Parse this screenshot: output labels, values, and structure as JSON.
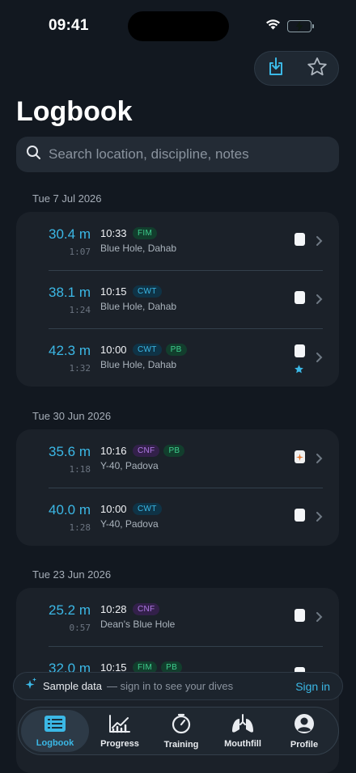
{
  "status": {
    "time": "09:41"
  },
  "header": {
    "title": "Logbook",
    "actions": [
      {
        "icon": "import-icon"
      },
      {
        "icon": "star-icon"
      }
    ]
  },
  "search": {
    "placeholder": "Search location, discipline, notes",
    "value": ""
  },
  "sections": [
    {
      "date": "Tue 7 Jul 2026",
      "dives": [
        {
          "depth": "30.4 m",
          "duration": "1:07",
          "time": "10:33",
          "tags": [
            "FIM"
          ],
          "location": "Blue Hole, Dahab",
          "thumb": "white",
          "starred": false
        },
        {
          "depth": "38.1 m",
          "duration": "1:24",
          "time": "10:15",
          "tags": [
            "CWT"
          ],
          "location": "Blue Hole, Dahab",
          "thumb": "white",
          "starred": false
        },
        {
          "depth": "42.3 m",
          "duration": "1:32",
          "time": "10:00",
          "tags": [
            "CWT",
            "PB"
          ],
          "location": "Blue Hole, Dahab",
          "thumb": "white",
          "starred": true
        }
      ]
    },
    {
      "date": "Tue 30 Jun 2026",
      "dives": [
        {
          "depth": "35.6 m",
          "duration": "1:18",
          "time": "10:16",
          "tags": [
            "CNF",
            "PB"
          ],
          "location": "Y-40, Padova",
          "thumb": "sun",
          "starred": false
        },
        {
          "depth": "40.0 m",
          "duration": "1:28",
          "time": "10:00",
          "tags": [
            "CWT"
          ],
          "location": "Y-40, Padova",
          "thumb": "white",
          "starred": false
        }
      ]
    },
    {
      "date": "Tue 23 Jun 2026",
      "dives": [
        {
          "depth": "25.2 m",
          "duration": "0:57",
          "time": "10:28",
          "tags": [
            "CNF"
          ],
          "location": "Dean's Blue Hole",
          "thumb": "white",
          "starred": false
        },
        {
          "depth": "32.0 m",
          "duration": "",
          "time": "10:15",
          "tags": [
            "FIM",
            "PB"
          ],
          "location": "",
          "thumb": "white",
          "starred": false
        }
      ]
    }
  ],
  "banner": {
    "label": "Sample data",
    "sub": "— sign in to see your dives",
    "action": "Sign in"
  },
  "tabs": [
    {
      "label": "Logbook",
      "icon": "logbook-icon",
      "active": true
    },
    {
      "label": "Progress",
      "icon": "chart-icon",
      "active": false
    },
    {
      "label": "Training",
      "icon": "timer-icon",
      "active": false
    },
    {
      "label": "Mouthfill",
      "icon": "lungs-icon",
      "active": false
    },
    {
      "label": "Profile",
      "icon": "person-icon",
      "active": false
    }
  ],
  "colors": {
    "accent": "#3bb8e6",
    "background": "#121820",
    "card": "#1b2129",
    "tag_green": "#3ecf8e",
    "tag_blue": "#3bb8e6",
    "tag_purple": "#b07ae6"
  }
}
